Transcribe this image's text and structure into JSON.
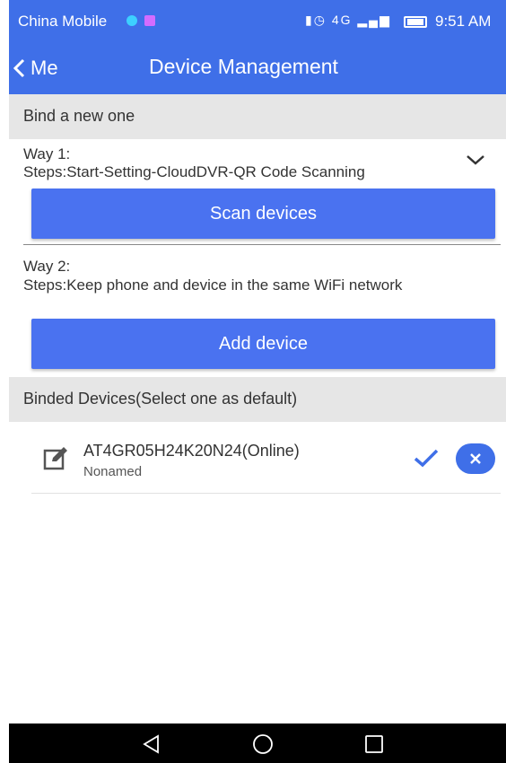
{
  "status_bar": {
    "carrier": "China Mobile",
    "network": "4G",
    "time": "9:51 AM"
  },
  "app_bar": {
    "back_label": "Me",
    "title": "Device Management"
  },
  "bind_section": {
    "header": "Bind a new one",
    "way1": {
      "title": "Way 1:",
      "steps": "Steps:Start-Setting-CloudDVR-QR Code Scanning",
      "button": "Scan devices"
    },
    "way2": {
      "title": "Way 2:",
      "steps": "Steps:Keep phone and device in the same WiFi network",
      "button": "Add device"
    }
  },
  "binded_section": {
    "header": "Binded Devices(Select one as default)",
    "devices": [
      {
        "name": "AT4GR05H24K20N24(Online)",
        "alias": "Nonamed"
      }
    ]
  },
  "colors": {
    "primary": "#3f6fe8",
    "button": "#4a72f0",
    "section_bg": "#e6e6e6"
  },
  "icons": [
    "back-chevron-icon",
    "expand-chevron-icon",
    "edit-icon",
    "check-icon",
    "close-icon",
    "nav-back-icon",
    "nav-home-icon",
    "nav-recent-icon"
  ]
}
